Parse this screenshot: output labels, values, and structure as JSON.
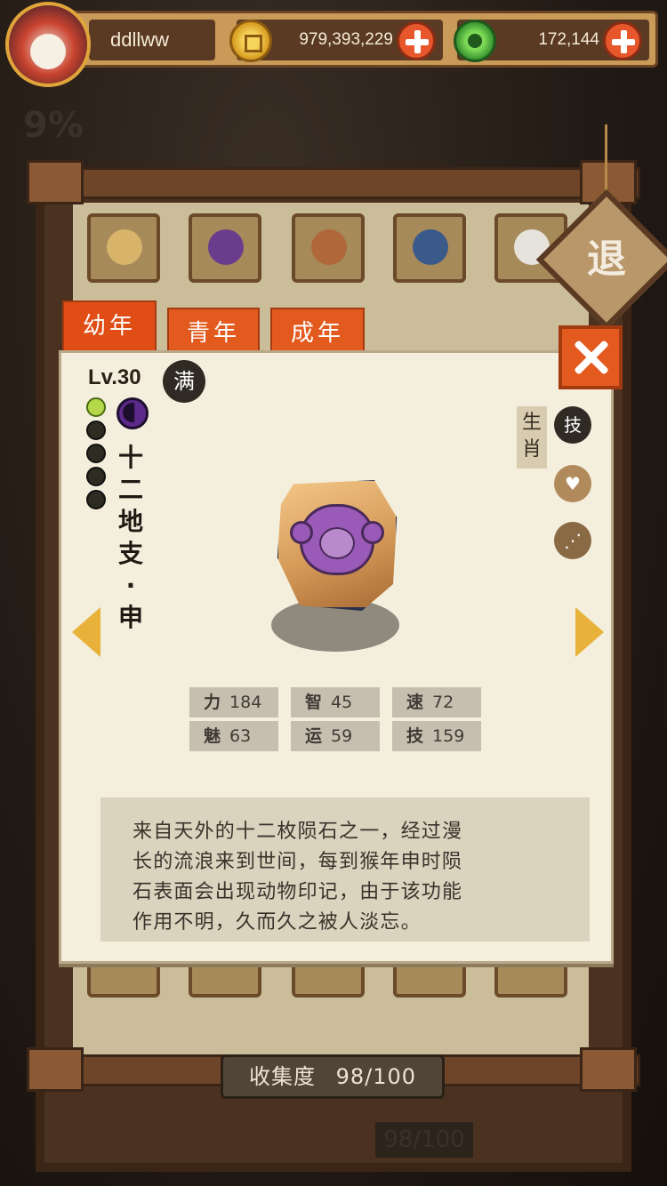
{
  "player": {
    "name": "ddllww"
  },
  "resources": {
    "gold": "979,393,229",
    "jade": "172,144"
  },
  "tabs": [
    "幼年",
    "青年",
    "成年"
  ],
  "retreat_label": "退",
  "detail": {
    "level": "Lv.30",
    "max_badge": "满",
    "name_chars": [
      "十",
      "二",
      "地",
      "支",
      "·",
      "申"
    ],
    "category": "生肖",
    "skill_icon_label": "技",
    "stats": [
      {
        "key": "力",
        "value": "184"
      },
      {
        "key": "智",
        "value": "45"
      },
      {
        "key": "速",
        "value": "72"
      },
      {
        "key": "魅",
        "value": "63"
      },
      {
        "key": "运",
        "value": "59"
      },
      {
        "key": "技",
        "value": "159"
      }
    ],
    "description_lines": [
      "来自天外的十二枚陨石之一，经过漫",
      "长的流浪来到世间，每到猴年申时陨",
      "石表面会出现动物印记，由于该功能",
      "作用不明，久而久之被人淡忘。"
    ]
  },
  "collection": {
    "label": "收集度",
    "value": "98/100",
    "ghost_value": "98/100"
  },
  "ghost_percent": "9%",
  "icons": {
    "gold": "gold-coin-icon",
    "jade": "jade-coin-icon",
    "close": "close-icon",
    "prev": "arrow-left-icon",
    "next": "arrow-right-icon",
    "heart": "heart-icon",
    "share": "share-icon"
  },
  "colors": {
    "accent_orange": "#e35a1f",
    "panel_bg": "#f4eedc",
    "arrow_yellow": "#e8b23a"
  }
}
